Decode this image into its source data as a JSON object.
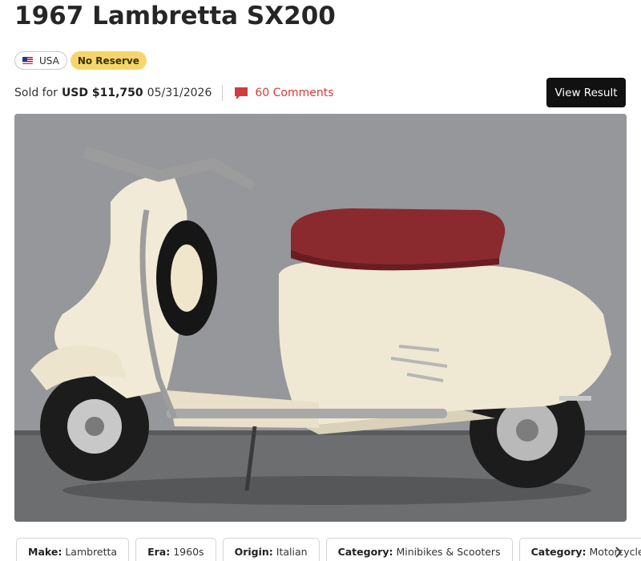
{
  "listing": {
    "title": "1967 Lambretta SX200",
    "country": "USA",
    "reserve": "No Reserve",
    "sold_label": "Sold for",
    "price": "USD $11,750",
    "date": "05/31/2026",
    "comments": "60 Comments",
    "view_result": "View Result"
  },
  "photo": {
    "subject": "cream Lambretta SX200 scooter with red seat and spare wheel"
  },
  "chips": [
    {
      "key": "Make:",
      "value": "Lambretta"
    },
    {
      "key": "Era:",
      "value": "1960s"
    },
    {
      "key": "Origin:",
      "value": "Italian"
    },
    {
      "key": "Category:",
      "value": "Minibikes & Scooters"
    },
    {
      "key": "Category:",
      "value": "Motorcycles"
    }
  ],
  "icons": {
    "comment": "comment-icon",
    "flag": "us-flag-icon",
    "scroll_right": "chevron-right-icon"
  },
  "colors": {
    "reserve_badge": "#f6d66a",
    "comments_accent": "#d23b3b",
    "button_bg": "#111111"
  }
}
